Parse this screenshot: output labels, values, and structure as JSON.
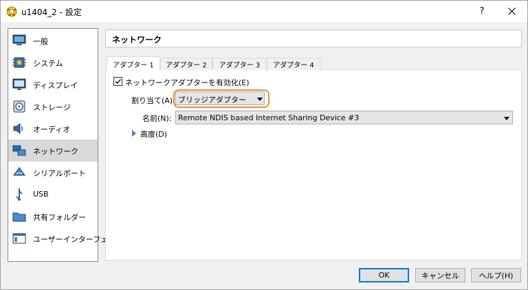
{
  "window": {
    "title": "u1404_2 - 設定",
    "help_label": "?"
  },
  "sidebar": {
    "items": [
      {
        "label": "一般",
        "icon": "monitor-icon"
      },
      {
        "label": "システム",
        "icon": "chip-icon"
      },
      {
        "label": "ディスプレイ",
        "icon": "display-icon"
      },
      {
        "label": "ストレージ",
        "icon": "disk-icon"
      },
      {
        "label": "オーディオ",
        "icon": "speaker-icon"
      },
      {
        "label": "ネットワーク",
        "icon": "network-icon",
        "selected": true
      },
      {
        "label": "シリアルポート",
        "icon": "serial-port-icon"
      },
      {
        "label": "USB",
        "icon": "usb-icon"
      },
      {
        "label": "共有フォルダー",
        "icon": "folder-icon"
      },
      {
        "label": "ユーザーインターフェース",
        "icon": "ui-icon"
      }
    ]
  },
  "page": {
    "title": "ネットワーク"
  },
  "tabs": [
    "アダプター 1",
    "アダプター 2",
    "アダプター 3",
    "アダプター 4"
  ],
  "adapter": {
    "enable_label": "ネットワークアダプターを有効化(E)",
    "enable_checked": true,
    "attach_label": "割り当て(A):",
    "attach_value": "ブリッジアダプター",
    "name_label": "名前(N):",
    "name_value": "Remote NDIS based Internet Sharing Device #3",
    "advanced_label": "高度(D)"
  },
  "buttons": {
    "ok": "OK",
    "cancel": "キャンセル",
    "help": "ヘルプ(H)"
  },
  "colors": {
    "accent": "#0078d7",
    "highlight_ring": "#e88a3a",
    "expander": "#3c87c8"
  }
}
